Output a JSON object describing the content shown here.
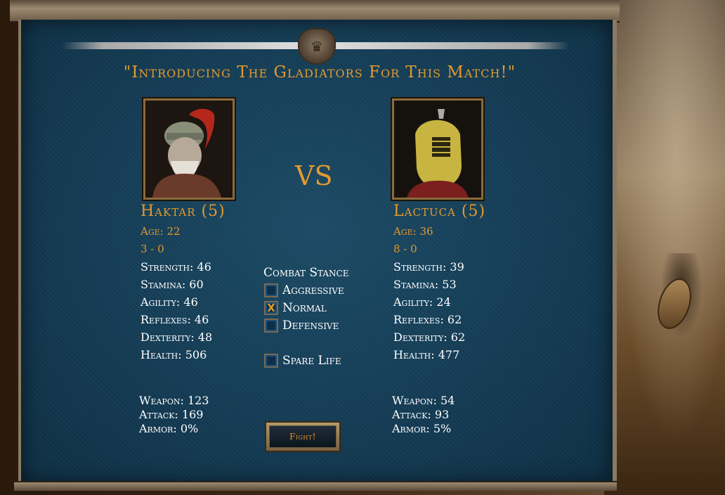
{
  "title": "\"Introducing The Gladiators For This Match!\"",
  "vs": "VS",
  "gladiators": [
    {
      "name": "Haktar (5)",
      "age": "Age: 22",
      "record": "3 - 0",
      "stats": [
        "Strength: 46",
        "Stamina: 60",
        "Agility: 46",
        "Reflexes: 46",
        "Dexterity: 48",
        "Health: 506"
      ],
      "weapon": "Weapon: 123",
      "attack": "Attack: 169",
      "armor": "Armor: 0%"
    },
    {
      "name": "Lactuca (5)",
      "age": "Age: 36",
      "record": "8 - 0",
      "stats": [
        "Strength: 39",
        "Stamina: 53",
        "Agility: 24",
        "Reflexes: 62",
        "Dexterity: 62",
        "Health: 477"
      ],
      "weapon": "Weapon: 54",
      "attack": "Attack: 93",
      "armor": "Armor: 5%"
    }
  ],
  "stance": {
    "title": "Combat Stance",
    "options": [
      {
        "label": "Aggressive",
        "mark": ""
      },
      {
        "label": "Normal",
        "mark": "X"
      },
      {
        "label": "Defensive",
        "mark": ""
      }
    ],
    "spare_life": {
      "label": "Spare Life",
      "mark": ""
    }
  },
  "fight_label": "Fight!",
  "colors": {
    "accent": "#e39a2f",
    "panel": "#133a52",
    "text": "#ffffff"
  }
}
